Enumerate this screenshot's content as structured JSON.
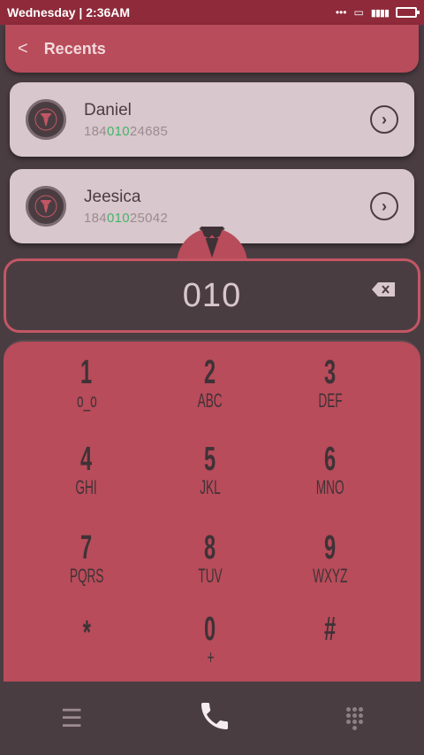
{
  "status": {
    "time": "Wednesday | 2:36AM",
    "dots": "•••"
  },
  "header": {
    "title": "Recents"
  },
  "recents": [
    {
      "name": "Daniel",
      "num_pre": "184",
      "num_match": "010",
      "num_post": "24685"
    },
    {
      "name": "Jeesica",
      "num_pre": "184",
      "num_match": "010",
      "num_post": "25042"
    }
  ],
  "display": {
    "digits": "010"
  },
  "keys": [
    {
      "num": "1",
      "letters": "o_o"
    },
    {
      "num": "2",
      "letters": "ABC"
    },
    {
      "num": "3",
      "letters": "DEF"
    },
    {
      "num": "4",
      "letters": "GHI"
    },
    {
      "num": "5",
      "letters": "JKL"
    },
    {
      "num": "6",
      "letters": "MNO"
    },
    {
      "num": "7",
      "letters": "PQRS"
    },
    {
      "num": "8",
      "letters": "TUV"
    },
    {
      "num": "9",
      "letters": "WXYZ"
    },
    {
      "num": "*",
      "letters": ""
    },
    {
      "num": "0",
      "letters": "+"
    },
    {
      "num": "#",
      "letters": ""
    }
  ],
  "colors": {
    "accent": "#b84c5a",
    "dark": "#4a3d42",
    "match": "#44b46a"
  }
}
